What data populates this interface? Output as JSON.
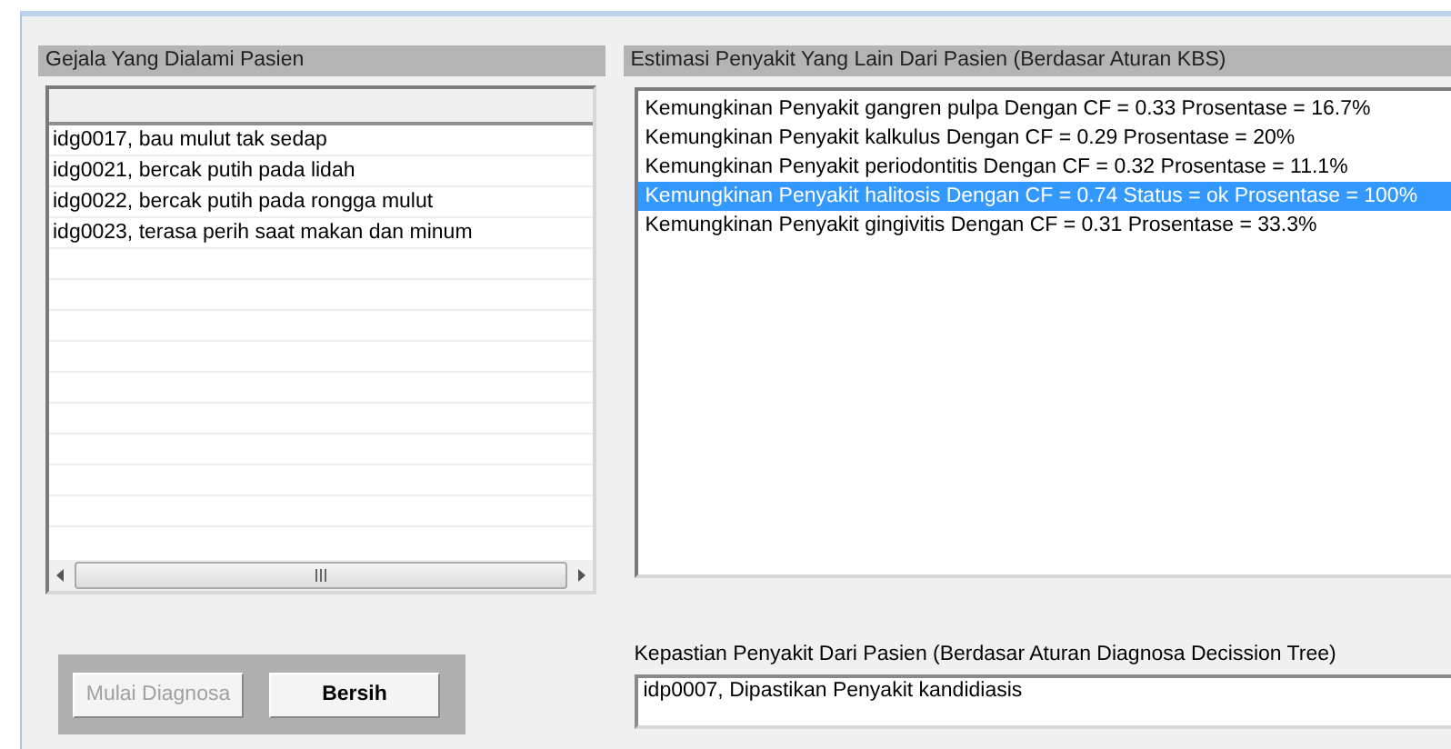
{
  "symptoms": {
    "title": "Gejala Yang Dialami Pasien",
    "items": [
      "idg0017, bau mulut tak sedap",
      "idg0021, bercak putih pada lidah",
      "idg0022, bercak putih pada rongga mulut",
      "idg0023, terasa perih saat makan dan minum"
    ]
  },
  "estimates": {
    "title": "Estimasi Penyakit Yang Lain Dari Pasien (Berdasar Aturan KBS)",
    "items": [
      {
        "text": "Kemungkinan Penyakit gangren pulpa Dengan CF = 0.33 Prosentase = 16.7%",
        "selected": false
      },
      {
        "text": "Kemungkinan Penyakit kalkulus Dengan CF = 0.29 Prosentase = 20%",
        "selected": false
      },
      {
        "text": "Kemungkinan Penyakit periodontitis Dengan CF = 0.32 Prosentase = 11.1%",
        "selected": false
      },
      {
        "text": "Kemungkinan Penyakit halitosis Dengan CF = 0.74 Status = ok Prosentase = 100%",
        "selected": true
      },
      {
        "text": "Kemungkinan Penyakit gingivitis Dengan CF = 0.31 Prosentase = 33.3%",
        "selected": false
      }
    ]
  },
  "buttons": [
    {
      "label": "Mulai Diagnosa",
      "disabled": true
    },
    {
      "label": "Bersih",
      "disabled": false
    }
  ],
  "certainty": {
    "title": "Kepastian Penyakit Dari Pasien (Berdasar Aturan Diagnosa Decission Tree)",
    "value": "idp0007, Dipastikan Penyakit kandidiasis"
  }
}
